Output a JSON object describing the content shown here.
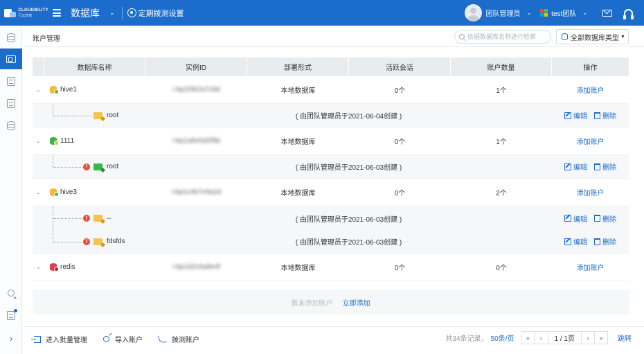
{
  "app": {
    "brand_en": "CLOUDBILITY",
    "brand_cn": "行云管家",
    "title": "数据库",
    "probe_settings": "定期拨测设置",
    "user_name": "团队管理员",
    "team_name": "test团队",
    "accent": "#1c6ccc"
  },
  "sidebar": {
    "items": [
      "database-icon",
      "account-card-icon",
      "document-icon",
      "clipboard-icon",
      "database-settings-icon"
    ],
    "bottom": [
      "search-icon",
      "task-icon",
      "chevron-right-icon"
    ]
  },
  "header": {
    "page_title": "账户管理",
    "search_placeholder": "依据数据库名称进行检索",
    "type_select": "全部数据库类型"
  },
  "table": {
    "columns": [
      "数据库名称",
      "实例ID",
      "部署形式",
      "活跃会话",
      "账户数量",
      "操作"
    ],
    "databases": [
      {
        "name": "hive1",
        "instance_id": "i-bp1f3k2a7c9d",
        "deploy": "本地数据库",
        "sessions": "0个",
        "accounts": "1个",
        "action": "添加账户",
        "sub": [
          {
            "name": "root",
            "created": "( 由团队管理员于2021-06-04创建 )",
            "warn": false
          }
        ]
      },
      {
        "name": "1111",
        "instance_id": "i-bp1a8e5d2f6b",
        "deploy": "本地数据库",
        "sessions": "0个",
        "accounts": "1个",
        "action": "添加账户",
        "sub": [
          {
            "name": "root",
            "created": "( 由团队管理员于2021-06-03创建 )",
            "warn": true
          }
        ]
      },
      {
        "name": "hive3",
        "instance_id": "i-bp1c4b7e9a2d",
        "deploy": "本地数据库",
        "sessions": "0个",
        "accounts": "2个",
        "action": "添加账户",
        "sub": [
          {
            "name": "--",
            "created": "( 由团队管理员于2021-06-03创建 )",
            "warn": true
          },
          {
            "name": "fdsfds",
            "created": "( 由团队管理员于2021-06-03创建 )",
            "warn": true
          }
        ]
      },
      {
        "name": "redis",
        "instance_id": "i-bp1d2c6a8e4f",
        "deploy": "本地数据库",
        "sessions": "0个",
        "accounts": "0个",
        "action": "添加账户",
        "sub": []
      }
    ],
    "edit_label": "编辑",
    "delete_label": "删除",
    "empty_text": "暂未添加账户",
    "add_now": "立即添加"
  },
  "footer": {
    "batch": "进入批量管理",
    "import": "导入账户",
    "probe": "拨测账户",
    "total": "共34条记录，",
    "page_size": "50条/页",
    "first": "«",
    "prev": "‹",
    "page_info": "1 / 1页",
    "next": "›",
    "last": "»",
    "jump": "跳转"
  }
}
